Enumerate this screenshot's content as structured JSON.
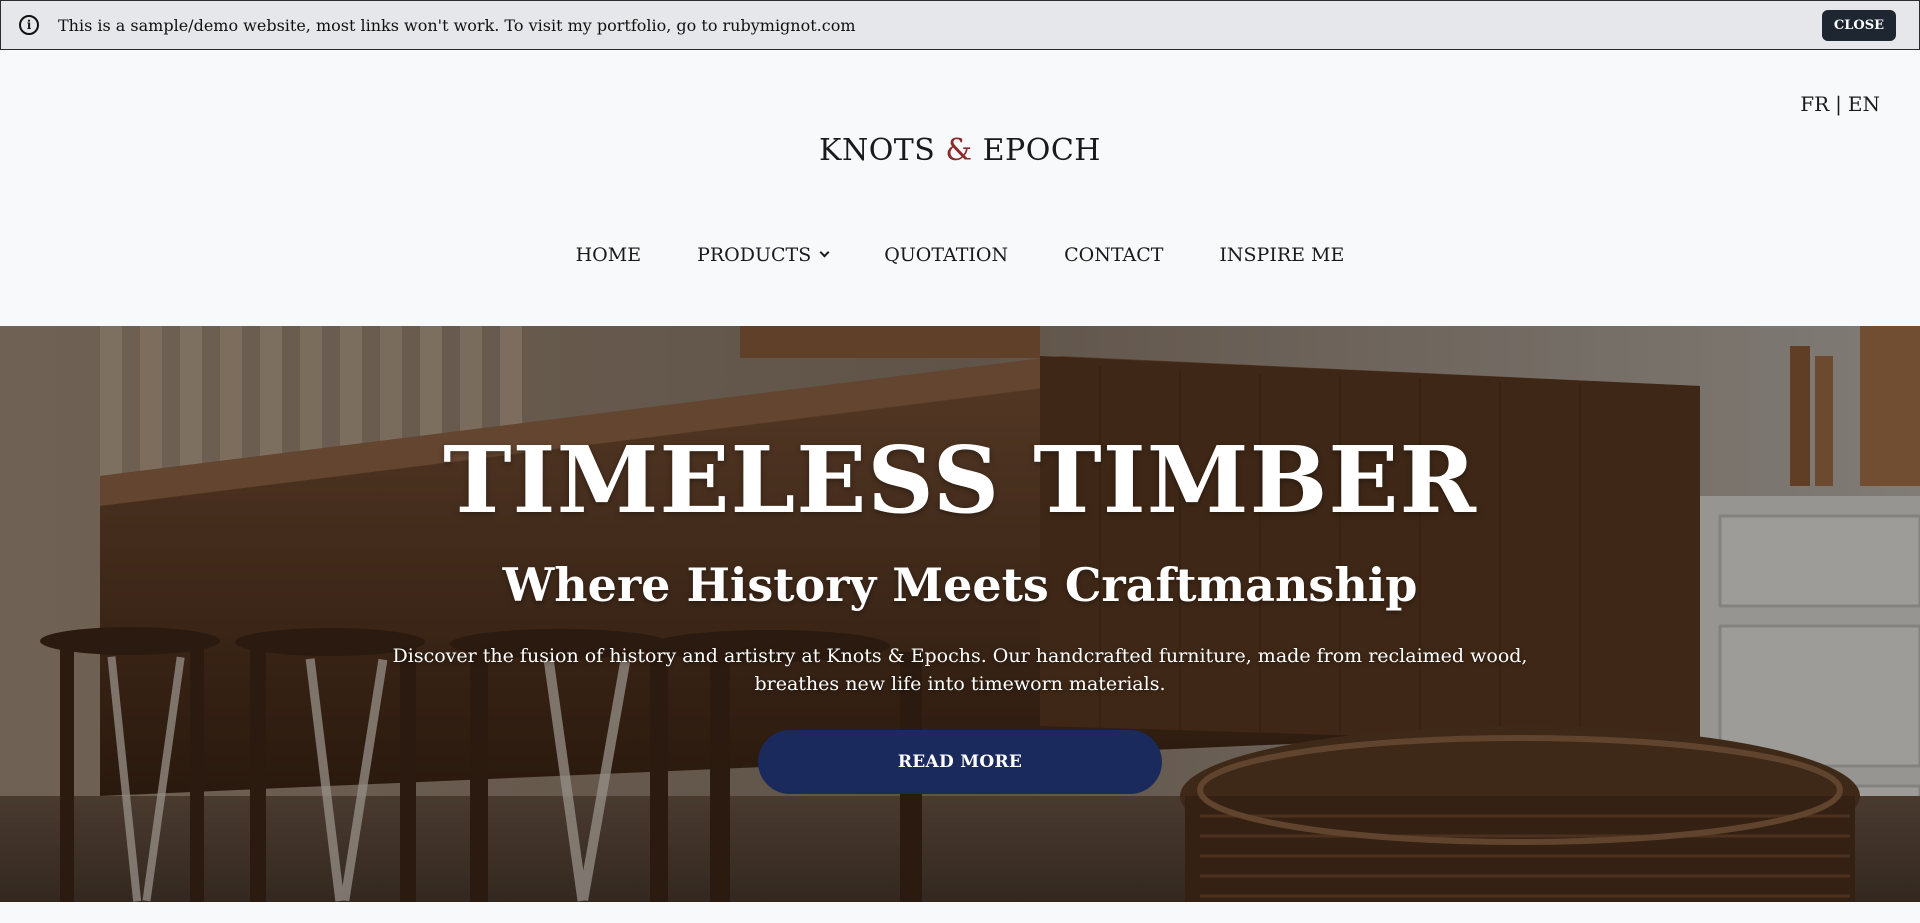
{
  "banner": {
    "icon": "info-icon",
    "text": "This is a sample/demo website, most links won't work. To visit my portfolio, go to rubymignot.com",
    "close_label": "CLOSE"
  },
  "header": {
    "lang": {
      "fr": "FR",
      "separator": "|",
      "en": "EN"
    },
    "logo": {
      "part1": "KNOTS ",
      "amp": "&",
      "part2": " EPOCH"
    },
    "nav": {
      "home": "HOME",
      "products": "PRODUCTS",
      "quotation": "QUOTATION",
      "contact": "CONTACT",
      "inspire": "INSPIRE ME"
    }
  },
  "hero": {
    "title": "TIMELESS TIMBER",
    "subtitle": "Where History Meets Craftmanship",
    "description": "Discover the fusion of history and artistry at Knots & Epochs. Our handcrafted furniture, made from reclaimed wood, breathes new life into timeworn materials.",
    "cta_label": "READ MORE"
  },
  "colors": {
    "accent_amp": "#8a2a2a",
    "cta_bg": "#1b2a5c",
    "banner_bg": "#e6e7ea",
    "close_bg": "#1e2631"
  }
}
